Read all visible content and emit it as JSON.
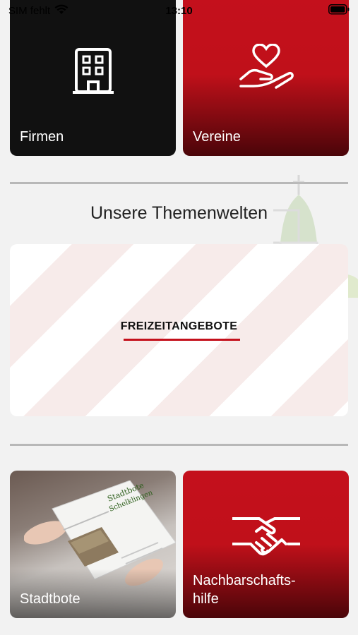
{
  "status": {
    "carrier": "SIM fehlt",
    "time": "13:10"
  },
  "tiles_top": [
    {
      "label": "Firmen",
      "icon": "building-icon"
    },
    {
      "label": "Vereine",
      "icon": "heart-hand-icon"
    }
  ],
  "section": {
    "title": "Unsere Themenwelten"
  },
  "banner": {
    "label": "FREIZEITANGEBOTE"
  },
  "tiles_bottom": [
    {
      "label": "Stadtbote",
      "icon": "newspaper-photo"
    },
    {
      "label_line1": "Nachbarschafts-",
      "label_line2": "hilfe",
      "icon": "handshake-icon"
    }
  ],
  "colors": {
    "accent": "#c4101c",
    "tile_dark": "#111111",
    "background": "#f2f2f2"
  }
}
